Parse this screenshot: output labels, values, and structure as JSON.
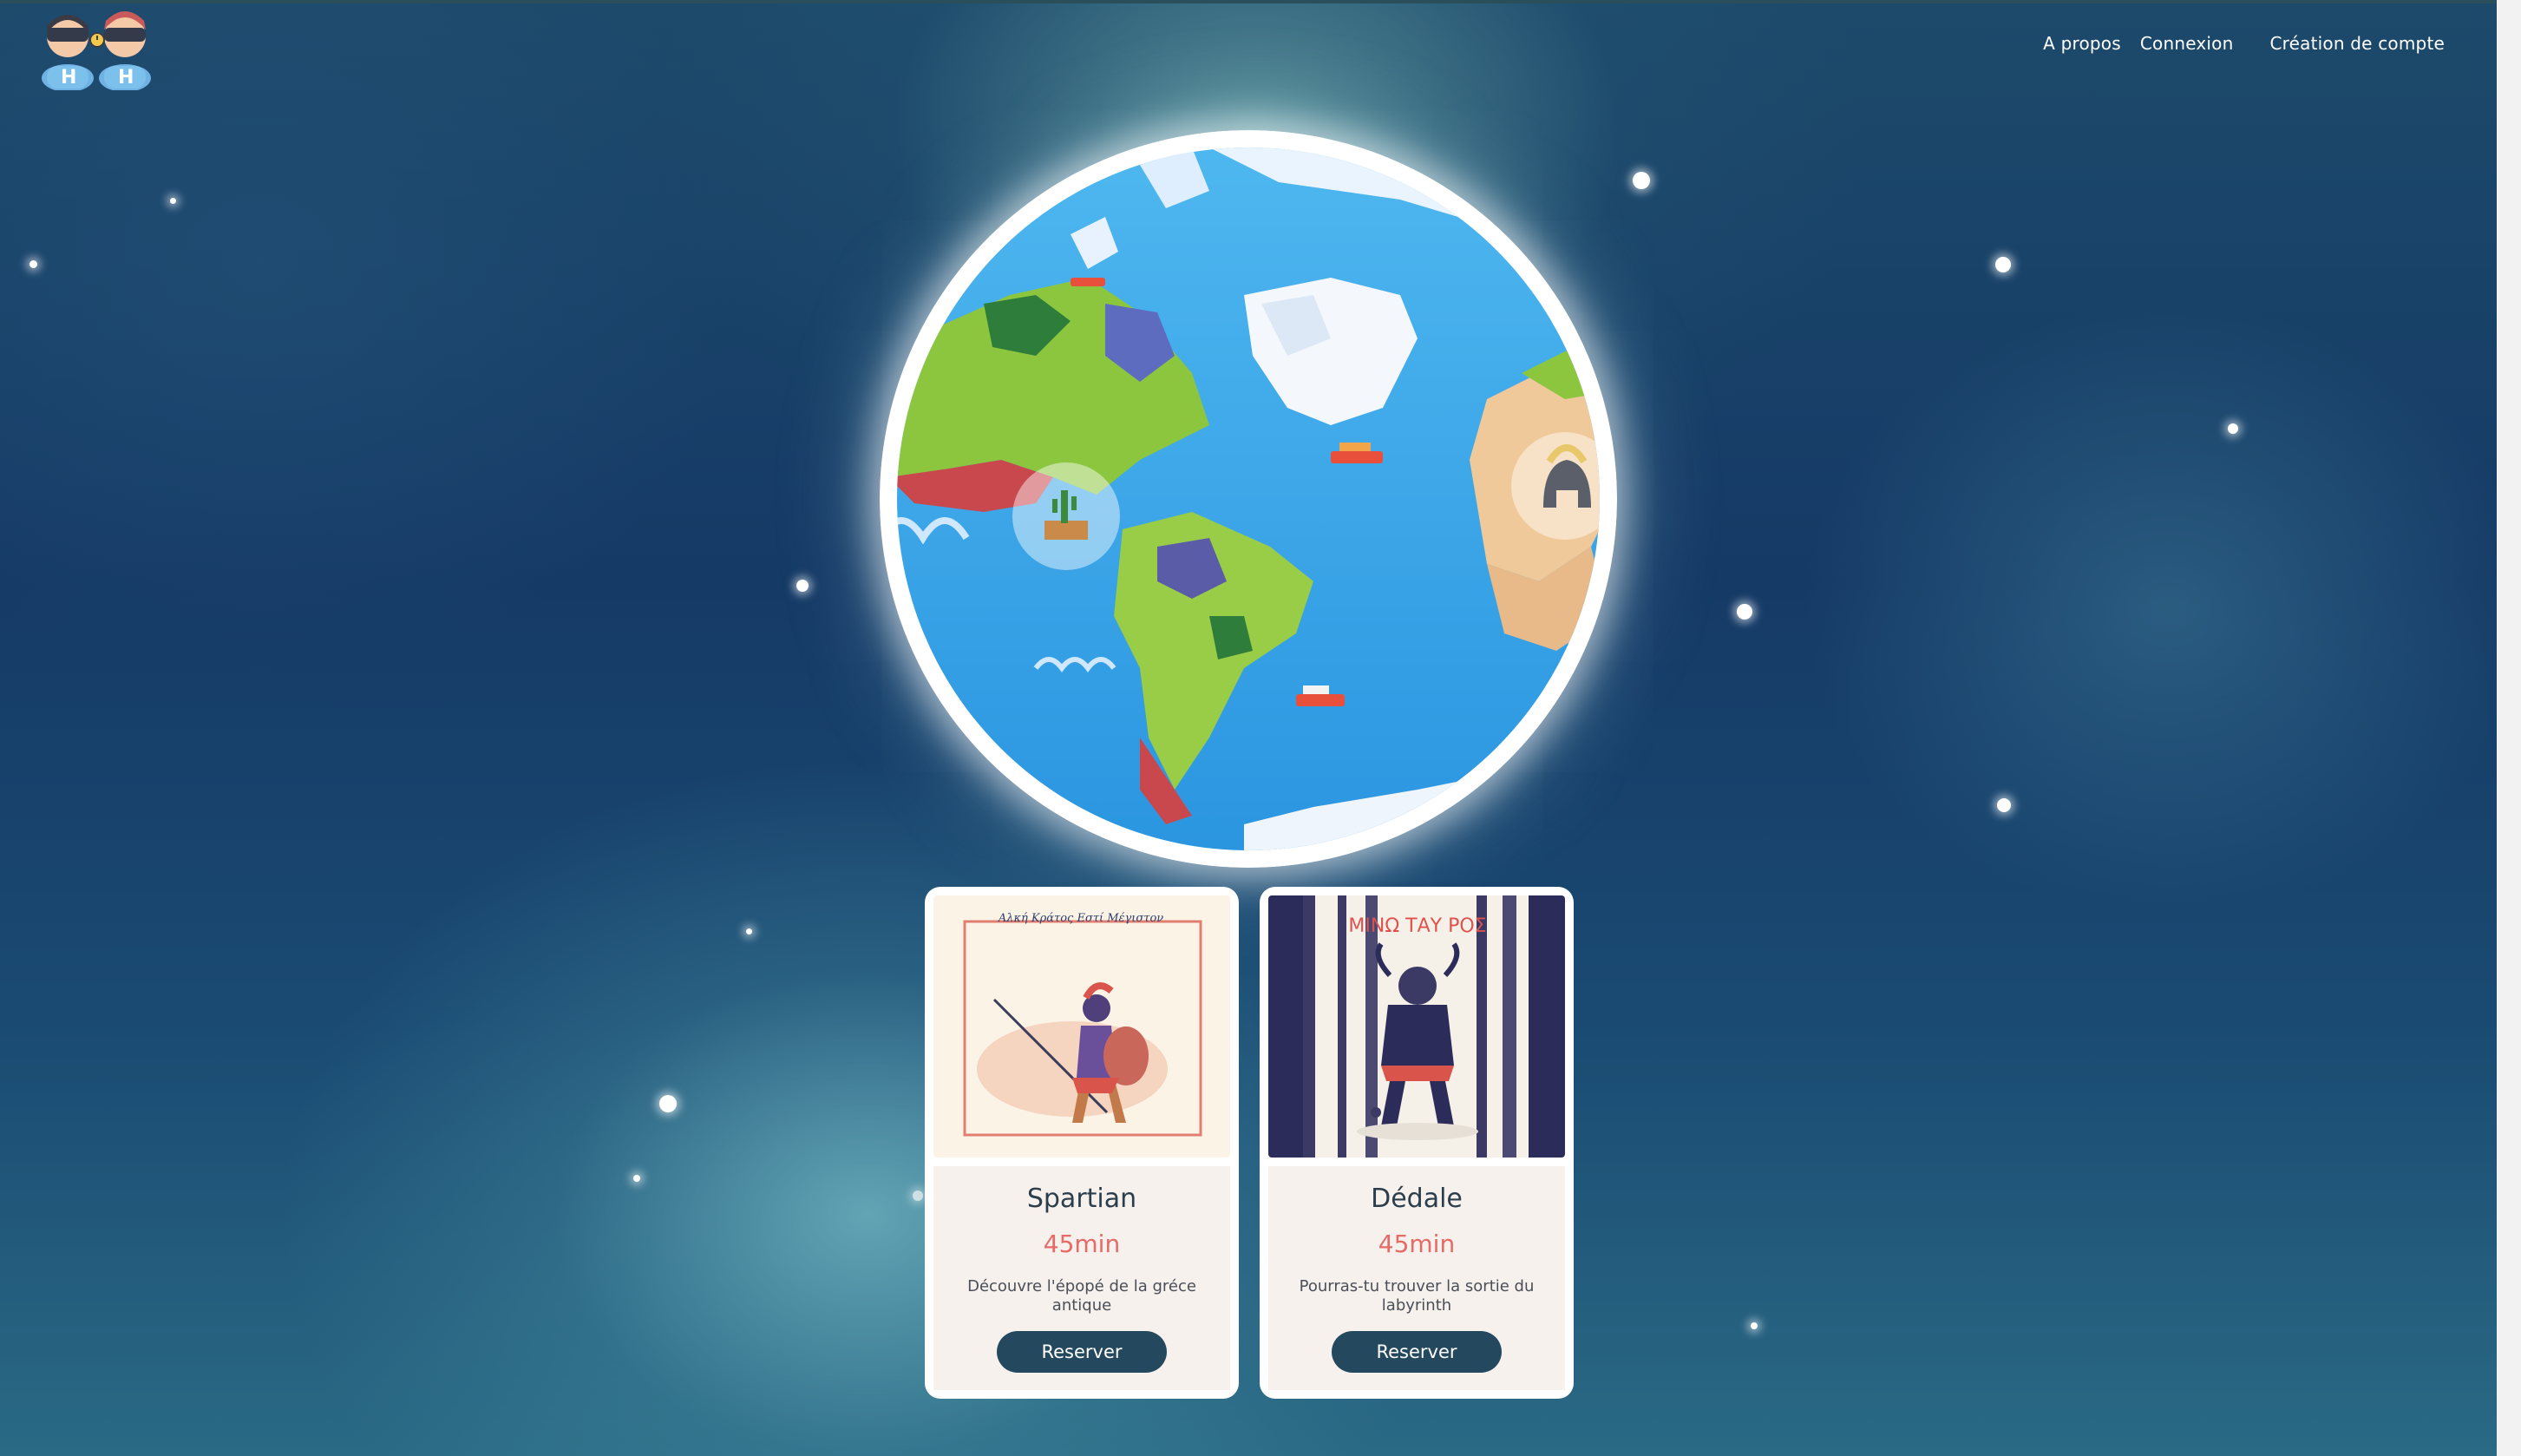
{
  "header": {
    "logo_icon": "vr-duo-mascots-logo",
    "nav": [
      {
        "label": "A propos"
      },
      {
        "label": "Connexion"
      },
      {
        "label": "Création de compte"
      }
    ]
  },
  "hero": {
    "image_icon": "low-poly-world-map-globe",
    "markers": [
      {
        "icon": "desert-cactus-marker"
      },
      {
        "icon": "spartan-helmet-marker"
      }
    ]
  },
  "experiences": [
    {
      "title": "Spartian",
      "duration": "45min",
      "description": "Découvre l'épopé de la gréce antique",
      "button": "Reserver",
      "poster_icon": "spartan-warrior-poster",
      "poster_caption": "Αλκή Κράτος Εστί Μέγιστον"
    },
    {
      "title": "Dédale",
      "duration": "45min",
      "description": "Pourras-tu trouver la sortie du labyrinth",
      "button": "Reserver",
      "poster_icon": "minotaur-forest-poster",
      "poster_caption": "ΜΙΝΩ ΤΑΥ ΡΟΣ"
    }
  ],
  "colors": {
    "button_bg": "#24495e",
    "duration_text": "#e66a66",
    "card_body_bg": "#f7f1ee",
    "title_text": "#2c3e4c"
  }
}
